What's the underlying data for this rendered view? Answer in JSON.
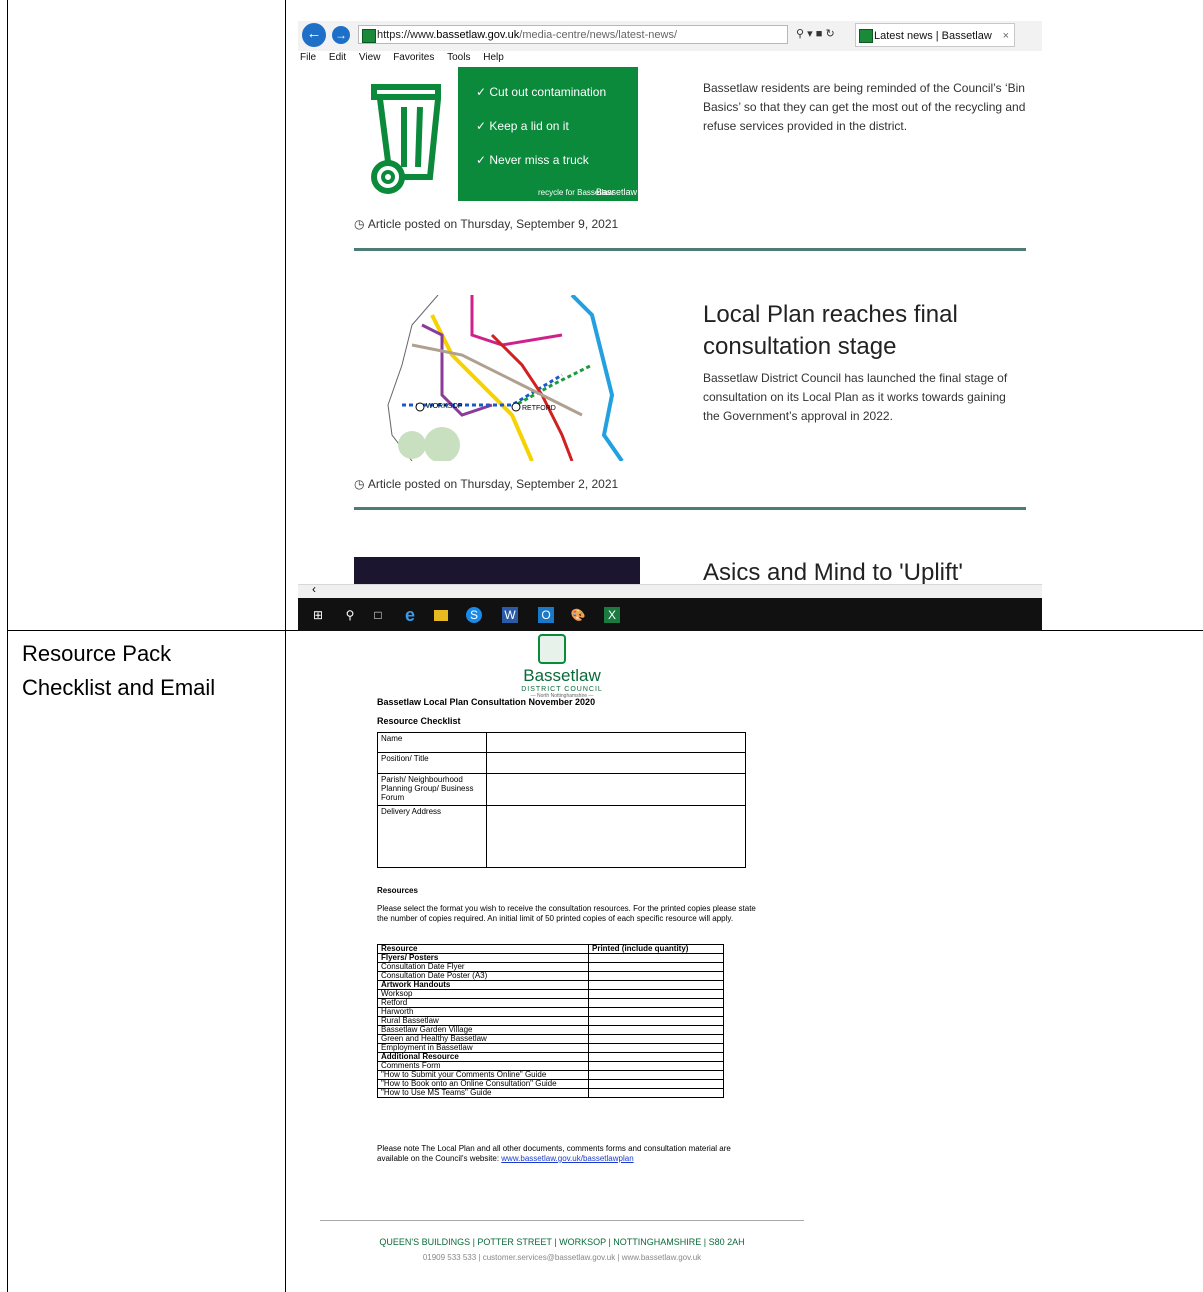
{
  "table": {
    "row2_label_line1": "Resource Pack",
    "row2_label_line2": "Checklist and Email"
  },
  "browser": {
    "url_prefix": "https://www.",
    "url_domain": "bassetlaw.gov.uk",
    "url_path": "/media-centre/news/latest-news/",
    "tab_title": "Latest news | Bassetlaw Dist...",
    "menu": [
      "File",
      "Edit",
      "View",
      "Favorites",
      "Tools",
      "Help"
    ],
    "green_box": {
      "items": [
        "Cut out contamination",
        "Keep a lid on it",
        "Never miss a truck"
      ],
      "logo1": "recycle for Bassetlaw",
      "logo2": "Bassetlaw"
    },
    "article1": {
      "text": "Bassetlaw residents are being reminded of the Council’s ‘Bin Basics’ so that they can get the most out of the recycling and refuse services provided in the district.",
      "posted": "Article posted on Thursday, September 9, 2021"
    },
    "article2": {
      "title_line1": "Local Plan reaches final",
      "title_line2": "consultation stage",
      "text": "Bassetlaw District Council has launched the final stage of consultation on its Local Plan as it works towards gaining the Government’s approval in 2022.",
      "posted": "Article posted on Thursday, September 2, 2021",
      "map_labels": [
        "WORKSOP",
        "RETFORD"
      ]
    },
    "article3": {
      "title": "Asics and Mind to 'Uplift'"
    }
  },
  "letter": {
    "council_name": "Bassetlaw",
    "council_sub": "DISTRICT COUNCIL",
    "council_tiny": "— North Nottinghamshire —",
    "title": "Bassetlaw Local Plan Consultation November 2020",
    "subtitle": "Resource Checklist",
    "checklist_rows": [
      "Name",
      "Position/ Title",
      "Parish/ Neighbourhood Planning Group/ Business Forum",
      "Delivery Address"
    ],
    "resources_heading": "Resources",
    "resources_para": "Please select the format you wish to receive the consultation resources. For the printed copies please state the number of copies required. An initial limit of 50 printed copies of each specific resource will apply.",
    "resource_table_header": [
      "Resource",
      "Printed (include quantity)"
    ],
    "resource_rows": [
      {
        "label": "Flyers/ Posters",
        "bold": true
      },
      {
        "label": "Consultation Date Flyer",
        "bold": false
      },
      {
        "label": "Consultation Date Poster (A3)",
        "bold": false
      },
      {
        "label": "Artwork Handouts",
        "bold": true
      },
      {
        "label": "Worksop",
        "bold": false
      },
      {
        "label": "Retford",
        "bold": false
      },
      {
        "label": "Harworth",
        "bold": false
      },
      {
        "label": "Rural Bassetlaw",
        "bold": false
      },
      {
        "label": "Bassetlaw Garden Village",
        "bold": false
      },
      {
        "label": "Green and Healthy Bassetlaw",
        "bold": false
      },
      {
        "label": "Employment in Bassetlaw",
        "bold": false
      },
      {
        "label": "Additional Resource",
        "bold": true
      },
      {
        "label": "Comments Form",
        "bold": false
      },
      {
        "label": "\"How to Submit your Comments Online\" Guide",
        "bold": false
      },
      {
        "label": "\"How to Book onto an Online Consultation\" Guide",
        "bold": false
      },
      {
        "label": "\"How to Use MS Teams\" Guide",
        "bold": false
      }
    ],
    "note_text": "Please note The Local Plan and all other documents, comments forms and consultation material are available on the Council's website:",
    "note_link": "www.bassetlaw.gov.uk/bassetlawplan",
    "footer_address": "QUEEN'S BUILDINGS   |   POTTER STREET   |   WORKSOP   |   NOTTINGHAMSHIRE   |   S80 2AH",
    "footer_contact": "01909 533 533   |   customer.services@bassetlaw.gov.uk   |   www.bassetlaw.gov.uk"
  },
  "colors": {
    "green": "#0a8a3a",
    "divider": "#4d7b76",
    "link": "#1a3acf"
  }
}
